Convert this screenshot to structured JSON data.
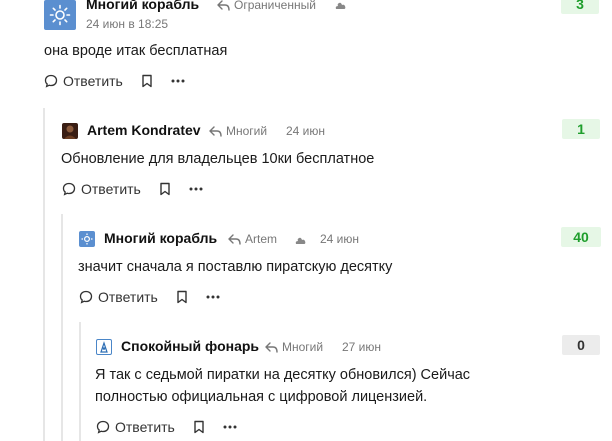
{
  "comments": [
    {
      "author": "Многий корабль",
      "reply_to": "Ограниченный",
      "date": "24 июн в 18:25",
      "text": "она вроде итак бесплатная",
      "score": "3"
    },
    {
      "author": "Artem Kondratev",
      "reply_to": "Многий",
      "date": "24 июн",
      "text": "Обновление для владельцев 10ки бесплатное",
      "score": "1"
    },
    {
      "author": "Многий корабль",
      "reply_to": "Artem",
      "date": "24 июн",
      "text": "значит сначала я поставлю пиратскую десятку",
      "score": "40"
    },
    {
      "author": "Спокойный фонарь",
      "reply_to": "Многий",
      "date": "27 июн",
      "text_line1": "Я так с седьмой пиратки на десятку обновился) Сейчас",
      "text_line2": "полностью официальная с цифровой лицензией.",
      "score": "0"
    }
  ],
  "actions": {
    "reply_label": "Ответить"
  },
  "colors": {
    "positive": "#1f9e2c",
    "accent_avatar": "#4a86c8"
  }
}
